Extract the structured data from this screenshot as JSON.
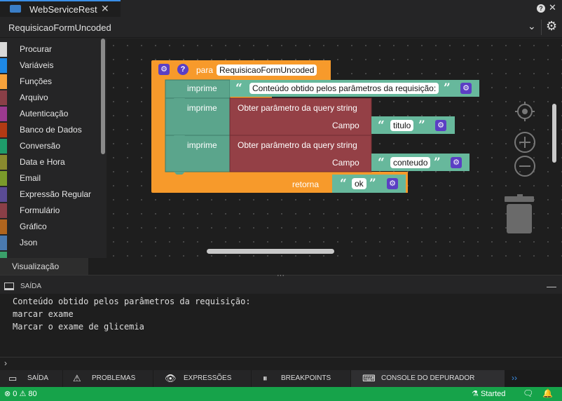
{
  "tab": {
    "title": "WebServiceRest",
    "close": "✕",
    "icon": "folder-icon"
  },
  "topright": {
    "help": "?",
    "close": "✕"
  },
  "form": {
    "name": "RequisicaoFormUncoded",
    "dropdown": "⌄",
    "settings": "⚙"
  },
  "toolbox": {
    "categories": [
      {
        "label": "Procurar",
        "color": "#d9d9d9"
      },
      {
        "label": "Variáveis",
        "color": "#1e88e5"
      },
      {
        "label": "Funções",
        "color": "#f7a23b"
      },
      {
        "label": "Arquivo",
        "color": "#8a3f47"
      },
      {
        "label": "Autenticação",
        "color": "#9b3a8f"
      },
      {
        "label": "Banco de Dados",
        "color": "#b23a14"
      },
      {
        "label": "Conversão",
        "color": "#1f9b6a"
      },
      {
        "label": "Data e Hora",
        "color": "#8a8a2e"
      },
      {
        "label": "Email",
        "color": "#7a9a2a"
      },
      {
        "label": "Expressão Regular",
        "color": "#5a4b94"
      },
      {
        "label": "Formulário",
        "color": "#8a3f47"
      },
      {
        "label": "Gráfico",
        "color": "#b0651e"
      },
      {
        "label": "Json",
        "color": "#4a7ab0"
      },
      {
        "label": "",
        "color": "#3aa06a"
      }
    ]
  },
  "blocks": {
    "func": {
      "keyword": "para",
      "name": "RequisicaoFormUncoded",
      "return_label": "retorna",
      "return_value": "ok"
    },
    "print1": {
      "label": "imprime",
      "text": "Conteúdo obtido pelos parâmetros da requisição:"
    },
    "print2": {
      "label": "imprime",
      "getter": "Obter parâmetro da query string",
      "field_label": "Campo",
      "field_value": "titulo"
    },
    "print3": {
      "label": "imprime",
      "getter": "Obter parâmetro da query string",
      "field_label": "Campo",
      "field_value": "conteudo"
    },
    "quote_open": "“",
    "quote_close": "”",
    "gear": "⚙",
    "help": "?"
  },
  "workspace_controls": {
    "center": "⊕",
    "zoom_in": "+",
    "zoom_out": "−"
  },
  "visualization_tab": "Visualização",
  "output": {
    "title": "SAÍDA",
    "minimize": "—",
    "lines": [
      "Conteúdo obtido pelos parâmetros da requisição:",
      "marcar exame",
      "Marcar o exame de glicemia"
    ],
    "prompt": "›"
  },
  "bottom_tabs": [
    {
      "label": "SAÍDA",
      "icon": "output-icon",
      "glyph": "▭"
    },
    {
      "label": "PROBLEMAS",
      "icon": "warning-icon",
      "glyph": "⚠"
    },
    {
      "label": "EXPRESSÕES",
      "icon": "eye-icon",
      "glyph": "👁"
    },
    {
      "label": "BREAKPOINTS",
      "icon": "pause-icon",
      "glyph": "⏸"
    },
    {
      "label": "CONSOLE DO DEPURADOR",
      "icon": "console-icon",
      "glyph": "⌨"
    }
  ],
  "more_tabs": "››",
  "status": {
    "errors": "0",
    "warnings": "80",
    "state": "Started",
    "error_glyph": "⊗",
    "warning_glyph": "⚠",
    "run_glyph": "⚗",
    "chat_glyph": "🗨",
    "bell_glyph": "🔔"
  }
}
